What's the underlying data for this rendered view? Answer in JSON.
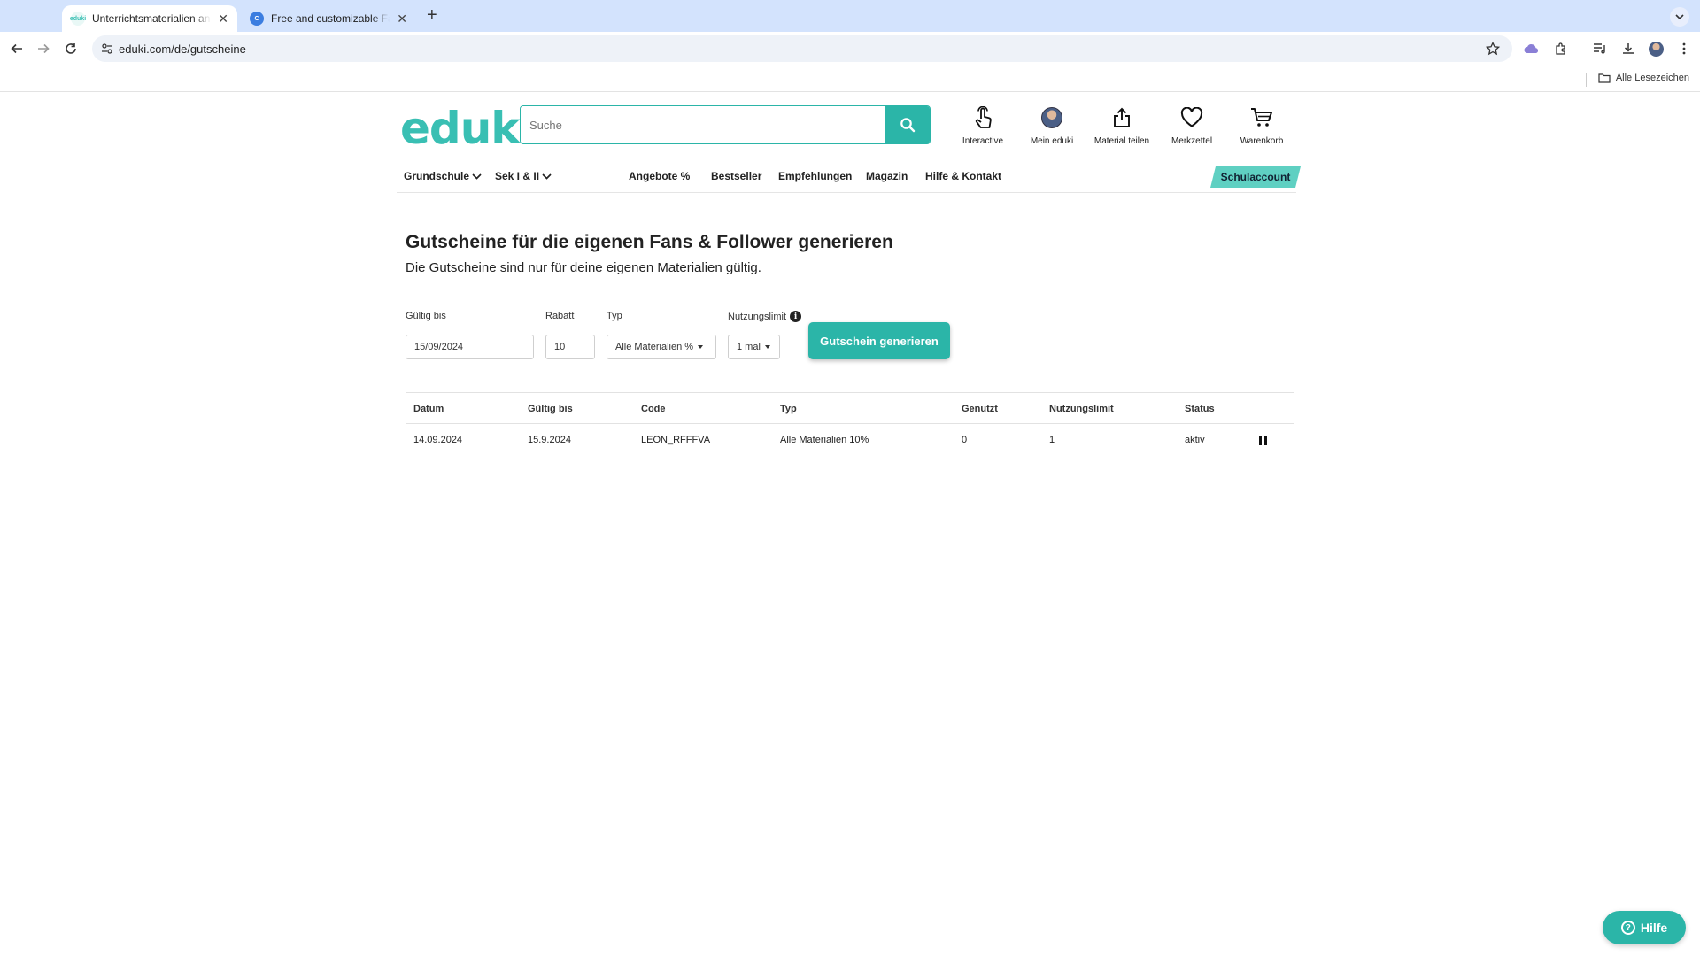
{
  "browser": {
    "tabs": [
      {
        "title": "Unterrichtsmaterialien anbieten",
        "favicon_text": "eduki",
        "active": true
      },
      {
        "title": "Free and customizable Facebook",
        "favicon_text": "C",
        "active": false
      }
    ],
    "url": "eduki.com/de/gutscheine",
    "bookmarks_all": "Alle Lesezeichen"
  },
  "header": {
    "logo": "eduki",
    "search_placeholder": "Suche",
    "nav": [
      {
        "label": "Interactive",
        "icon": "hand-pointer-icon"
      },
      {
        "label": "Mein eduki",
        "icon": "avatar"
      },
      {
        "label": "Material teilen",
        "icon": "share-upload-icon"
      },
      {
        "label": "Merkzettel",
        "icon": "heart-icon"
      },
      {
        "label": "Warenkorb",
        "icon": "cart-icon"
      }
    ]
  },
  "menu": {
    "items": [
      {
        "label": "Grundschule",
        "dropdown": true
      },
      {
        "label": "Sek I & II",
        "dropdown": true
      },
      {
        "label": "Angebote %"
      },
      {
        "label": "Bestseller"
      },
      {
        "label": "Empfehlungen"
      },
      {
        "label": "Magazin"
      },
      {
        "label": "Hilfe & Kontakt"
      }
    ],
    "school_account": "Schulaccount"
  },
  "page": {
    "title": "Gutscheine für die eigenen Fans & Follower generieren",
    "subtitle": "Die Gutscheine sind nur für deine eigenen Materialien gültig."
  },
  "form": {
    "valid_until_label": "Gültig bis",
    "valid_until_value": "15/09/2024",
    "discount_label": "Rabatt",
    "discount_value": "10",
    "type_label": "Typ",
    "type_value": "Alle Materialien %",
    "limit_label": "Nutzungslimit",
    "limit_value": "1 mal",
    "generate_button": "Gutschein generieren"
  },
  "table": {
    "headers": [
      "Datum",
      "Gültig bis",
      "Code",
      "Typ",
      "Genutzt",
      "Nutzungslimit",
      "Status"
    ],
    "rows": [
      {
        "datum": "14.09.2024",
        "gueltig_bis": "15.9.2024",
        "code": "LEON_RFFFVA",
        "typ": "Alle Materialien 10%",
        "genutzt": "0",
        "limit": "1",
        "status": "aktiv"
      }
    ]
  },
  "help_button": "Hilfe",
  "colors": {
    "brand": "#2bb5a8",
    "brand_light": "#5fd0c2",
    "tabstrip": "#d3e3fd"
  }
}
